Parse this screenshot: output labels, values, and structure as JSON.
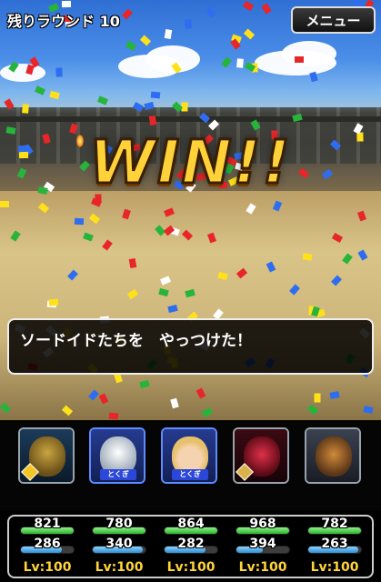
{
  "hud": {
    "round_label": "残りラウンド 10",
    "menu_label": "メニュー"
  },
  "banner": {
    "text": "WIN!!"
  },
  "message": {
    "text": "ソードイドたちを　やっつけた！"
  },
  "party": [
    {
      "id": "ally1",
      "tag": "",
      "hp": "821",
      "mp": "286",
      "mp_fraction": 0.78,
      "lv": "Lv:100"
    },
    {
      "id": "ally2",
      "tag": "とくぎ",
      "hp": "780",
      "mp": "340",
      "mp_fraction": 0.95,
      "lv": "Lv:100"
    },
    {
      "id": "ally3",
      "tag": "とくぎ",
      "hp": "864",
      "mp": "282",
      "mp_fraction": 0.78,
      "lv": "Lv:100"
    },
    {
      "id": "ally4",
      "tag": "",
      "hp": "968",
      "mp": "394",
      "mp_fraction": 0.5,
      "lv": "Lv:100"
    },
    {
      "id": "ally5",
      "tag": "",
      "hp": "782",
      "mp": "263",
      "mp_fraction": 0.95,
      "lv": "Lv:100"
    }
  ]
}
